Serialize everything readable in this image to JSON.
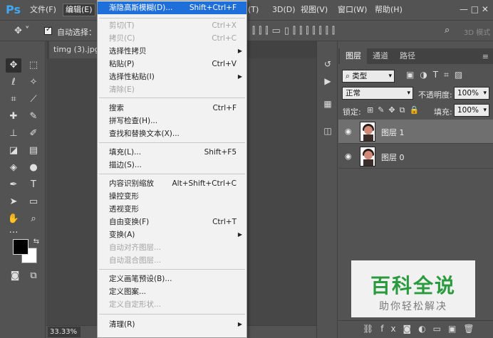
{
  "app": {
    "logo": "Ps"
  },
  "menubar": {
    "items": [
      "文件(F)",
      "编辑(E)",
      "(T)",
      "3D(D)",
      "视图(V)",
      "窗口(W)",
      "帮助(H)"
    ],
    "window_controls": "—  □  ✕"
  },
  "options_bar": {
    "auto_select_label": "自动选择：",
    "mode_3d": "3D 模式"
  },
  "document": {
    "tab_label": "timg (3).jpg",
    "zoom": "33.33%"
  },
  "edit_menu": {
    "items": [
      {
        "label": "渐隐高斯模糊(D)...",
        "shortcut": "Shift+Ctrl+F",
        "state": "highlighted"
      },
      {
        "label": "剪切(T)",
        "shortcut": "Ctrl+X",
        "state": "disabled"
      },
      {
        "label": "拷贝(C)",
        "shortcut": "Ctrl+C",
        "state": "disabled"
      },
      {
        "label": "选择性拷贝",
        "shortcut": "",
        "state": "submenu"
      },
      {
        "label": "粘贴(P)",
        "shortcut": "Ctrl+V",
        "state": "enabled"
      },
      {
        "label": "选择性粘贴(I)",
        "shortcut": "",
        "state": "submenu"
      },
      {
        "label": "清除(E)",
        "shortcut": "",
        "state": "disabled"
      },
      {
        "label": "搜索",
        "shortcut": "Ctrl+F",
        "state": "enabled"
      },
      {
        "label": "拼写检查(H)...",
        "shortcut": "",
        "state": "enabled"
      },
      {
        "label": "查找和替换文本(X)...",
        "shortcut": "",
        "state": "enabled"
      },
      {
        "label": "填充(L)...",
        "shortcut": "Shift+F5",
        "state": "enabled"
      },
      {
        "label": "描边(S)...",
        "shortcut": "",
        "state": "enabled"
      },
      {
        "label": "内容识别缩放",
        "shortcut": "Alt+Shift+Ctrl+C",
        "state": "enabled"
      },
      {
        "label": "操控变形",
        "shortcut": "",
        "state": "enabled"
      },
      {
        "label": "透视变形",
        "shortcut": "",
        "state": "enabled"
      },
      {
        "label": "自由变换(F)",
        "shortcut": "Ctrl+T",
        "state": "enabled"
      },
      {
        "label": "变换(A)",
        "shortcut": "",
        "state": "submenu"
      },
      {
        "label": "自动对齐图层...",
        "shortcut": "",
        "state": "disabled"
      },
      {
        "label": "自动混合图层...",
        "shortcut": "",
        "state": "disabled"
      },
      {
        "label": "定义画笔预设(B)...",
        "shortcut": "",
        "state": "enabled"
      },
      {
        "label": "定义图案...",
        "shortcut": "",
        "state": "enabled"
      },
      {
        "label": "定义自定形状...",
        "shortcut": "",
        "state": "disabled"
      },
      {
        "label": "清理(R)",
        "shortcut": "",
        "state": "submenu"
      }
    ]
  },
  "layers_panel": {
    "tabs": [
      "图层",
      "通道",
      "路径"
    ],
    "filter_label": "类型",
    "blend_mode": "正常",
    "opacity_label": "不透明度:",
    "opacity_value": "100%",
    "lock_label": "锁定:",
    "fill_label": "填充:",
    "fill_value": "100%",
    "layers": [
      {
        "name": "图层 1",
        "selected": true
      },
      {
        "name": "图层 0",
        "selected": false
      }
    ],
    "footer_icons": [
      "link-icon",
      "fx-icon",
      "mask-icon",
      "adjustment-icon",
      "folder-icon",
      "new-layer-icon",
      "trash-icon"
    ]
  },
  "watermark": {
    "title": "百科全说",
    "subtitle": "助你轻松解决"
  },
  "colors": {
    "highlight": "#1e6fd9",
    "watermark_green": "#2a9a3e",
    "ui_gray": "#535353"
  }
}
